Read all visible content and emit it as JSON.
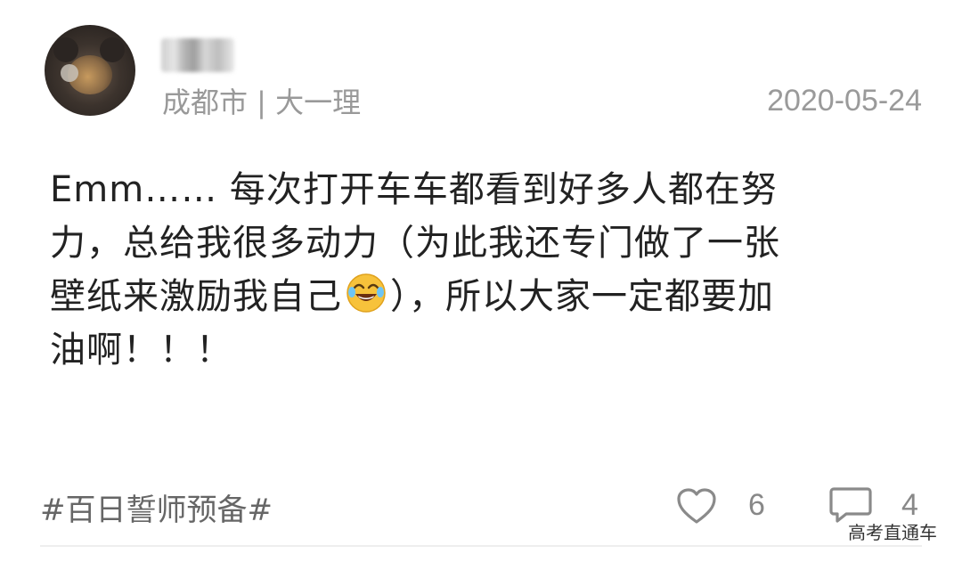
{
  "post": {
    "location_major": "成都市 | 大一理",
    "date": "2020-05-24",
    "content_lines": [
      "Emm…… 每次打开车车都看到好多人都在努",
      "力，总给我很多动力（为此我还专门做了一张",
      "壁纸来激励我自己",
      "），所以大家一定都要加",
      "油啊！！！"
    ],
    "emoji": "face-with-tears-of-joy",
    "hashtag": "#百日誓师预备#",
    "like_count": "6",
    "comment_count": "4"
  },
  "icons": {
    "like": "heart-outline-icon",
    "comment": "speech-bubble-icon"
  },
  "watermark": "高考直通车",
  "colors": {
    "text": "#222222",
    "meta": "#999999",
    "icon": "#888888"
  }
}
